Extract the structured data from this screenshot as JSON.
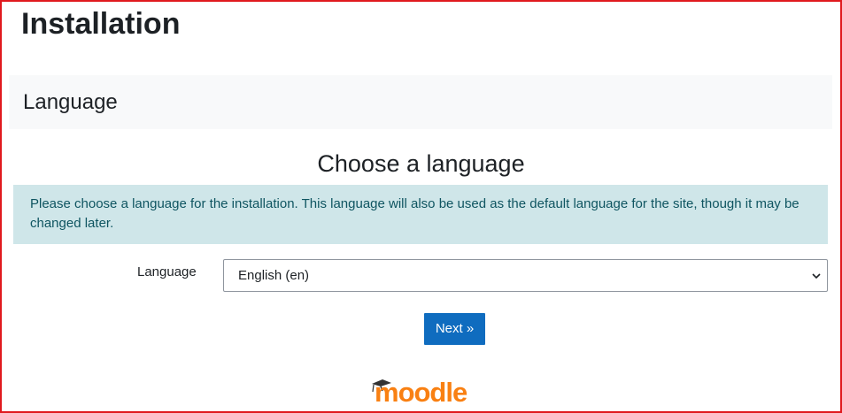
{
  "header": {
    "title": "Installation"
  },
  "section": {
    "title": "Language"
  },
  "main": {
    "heading": "Choose a language",
    "info_text": "Please choose a language for the installation. This language will also be used as the default language for the site, though it may be changed later.",
    "language_label": "Language",
    "language_selected": "English (en)",
    "next_label": "Next »"
  },
  "footer": {
    "logo": "moodle",
    "logo_icon": "graduation-cap-icon"
  },
  "colors": {
    "accent": "#0f6cbf",
    "info_bg": "#cfe6e9",
    "info_text": "#0f5561",
    "logo_orange": "#f98012",
    "frame_border": "#e0191e"
  }
}
